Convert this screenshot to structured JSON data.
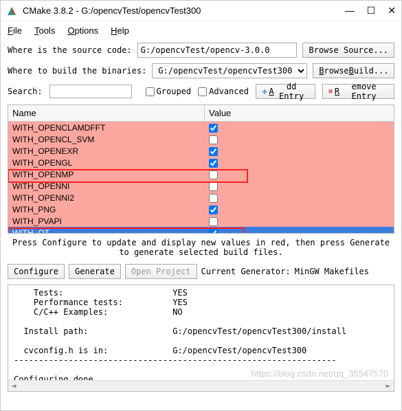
{
  "titlebar": {
    "title": "CMake 3.8.2 - G:/opencvTest/opencvTest300"
  },
  "menu": {
    "file": "File",
    "tools": "Tools",
    "options": "Options",
    "help": "Help"
  },
  "source": {
    "label": "Where is the source code:",
    "value": "G:/opencvTest/opencv-3.0.0",
    "browse": "Browse Source..."
  },
  "build": {
    "label": "Where to build the binaries:",
    "value": "G:/opencvTest/opencvTest300",
    "browse": "Browse Build..."
  },
  "search": {
    "label": "Search:",
    "value": ""
  },
  "grouped": {
    "label": "Grouped"
  },
  "advanced": {
    "label": "Advanced"
  },
  "addentry": {
    "label": "Add Entry"
  },
  "removeentry": {
    "label": "Remove Entry"
  },
  "grid": {
    "name_header": "Name",
    "value_header": "Value",
    "rows": [
      {
        "name": "WITH_OPENCLAMDFFT",
        "checked": true
      },
      {
        "name": "WITH_OPENCL_SVM",
        "checked": false
      },
      {
        "name": "WITH_OPENEXR",
        "checked": true
      },
      {
        "name": "WITH_OPENGL",
        "checked": true
      },
      {
        "name": "WITH_OPENMP",
        "checked": false
      },
      {
        "name": "WITH_OPENNI",
        "checked": false
      },
      {
        "name": "WITH_OPENNI2",
        "checked": false
      },
      {
        "name": "WITH_PNG",
        "checked": true
      },
      {
        "name": "WITH_PVAPI",
        "checked": false
      },
      {
        "name": "WITH_QT",
        "checked": true
      }
    ]
  },
  "hint": "Press Configure to update and display new values in red, then press Generate to generate selected build files.",
  "configure": "Configure",
  "generate": "Generate",
  "openproject": "Open Project",
  "currentgen_label": "Current Generator:",
  "currentgen_value": "MinGW Makefiles",
  "output": {
    "l1": "    Tests:                      YES",
    "l2": "    Performance tests:          YES",
    "l3": "    C/C++ Examples:             NO",
    "l4": "",
    "l5": "  Install path:                 G:/opencvTest/opencvTest300/install",
    "l6": "",
    "l7": "  cvconfig.h is in:             G:/opencvTest/opencvTest300",
    "l8": "-----------------------------------------------------------------",
    "l9": "",
    "l10": "Configuring done"
  },
  "watermark": "https://blog.csdn.net/qq_35547570"
}
